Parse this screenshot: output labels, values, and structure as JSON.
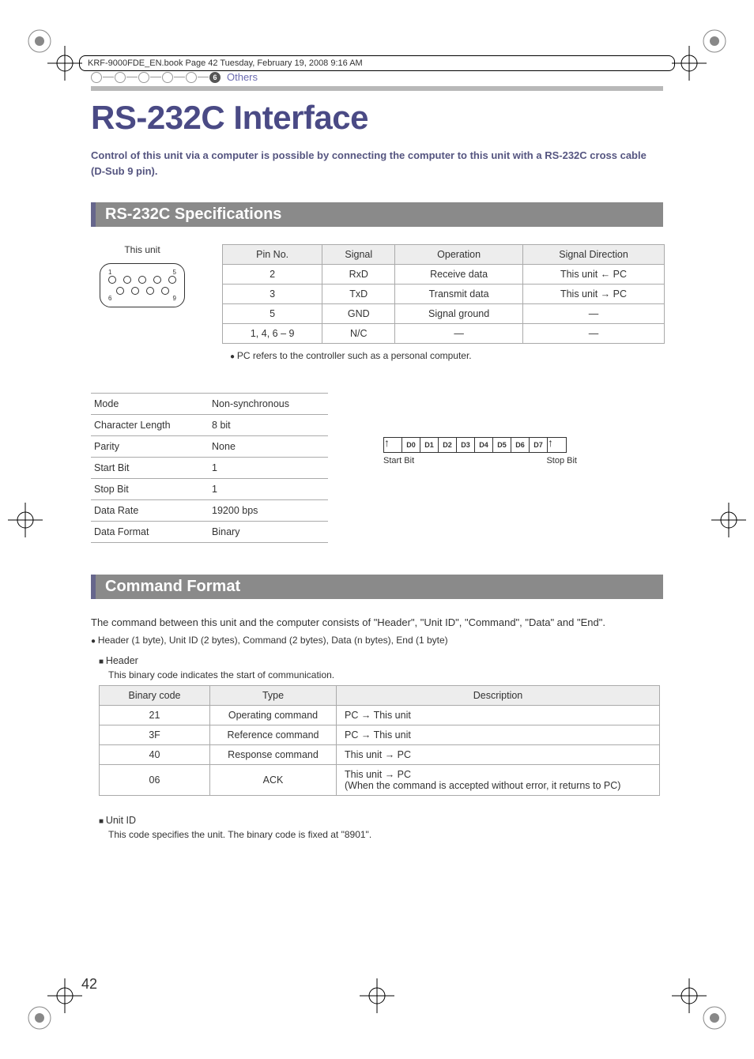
{
  "book_header": "KRF-9000FDE_EN.book  Page 42  Tuesday, February 19, 2008  9:16 AM",
  "breadcrumb": {
    "active_index": "6",
    "label": "Others"
  },
  "title": "RS-232C Interface",
  "intro": "Control of this unit via a computer is possible by connecting the computer to this unit with a RS-232C cross cable (D-Sub 9 pin).",
  "section1_head": "RS-232C Specifications",
  "connector_label": "This unit",
  "spec_headers": [
    "Pin No.",
    "Signal",
    "Operation",
    "Signal Direction"
  ],
  "spec_rows": [
    {
      "pin": "2",
      "signal": "RxD",
      "op": "Receive data",
      "dir": "This unit ← PC"
    },
    {
      "pin": "3",
      "signal": "TxD",
      "op": "Transmit data",
      "dir": "This unit → PC"
    },
    {
      "pin": "5",
      "signal": "GND",
      "op": "Signal ground",
      "dir": "—"
    },
    {
      "pin": "1, 4, 6 – 9",
      "signal": "N/C",
      "op": "—",
      "dir": "—"
    }
  ],
  "spec_note": "PC refers to the controller such as a personal computer.",
  "params": [
    {
      "k": "Mode",
      "v": "Non-synchronous"
    },
    {
      "k": "Character Length",
      "v": "8 bit"
    },
    {
      "k": "Parity",
      "v": "None"
    },
    {
      "k": "Start Bit",
      "v": "1"
    },
    {
      "k": "Stop Bit",
      "v": "1"
    },
    {
      "k": "Data Rate",
      "v": "19200 bps"
    },
    {
      "k": "Data Format",
      "v": "Binary"
    }
  ],
  "bits": [
    "D0",
    "D1",
    "D2",
    "D3",
    "D4",
    "D5",
    "D6",
    "D7"
  ],
  "bit_start": "Start Bit",
  "bit_stop": "Stop Bit",
  "section2_head": "Command Format",
  "cmd_intro": "The command between this unit and the computer consists of \"Header\", \"Unit ID\", \"Command\", \"Data\" and \"End\".",
  "cmd_note": "Header (1 byte), Unit ID (2 bytes), Command (2 bytes), Data (n bytes), End (1 byte)",
  "header_label": "Header",
  "header_desc": "This binary code indicates the start of communication.",
  "header_tbl_headers": [
    "Binary code",
    "Type",
    "Description"
  ],
  "header_tbl_rows": [
    {
      "code": "21",
      "type": "Operating command",
      "desc": "PC → This unit"
    },
    {
      "code": "3F",
      "type": "Reference command",
      "desc": "PC → This unit"
    },
    {
      "code": "40",
      "type": "Response command",
      "desc": "This unit → PC"
    },
    {
      "code": "06",
      "type": "ACK",
      "desc": "This unit → PC\n(When the command is accepted without error, it returns to PC)"
    }
  ],
  "unitid_label": "Unit ID",
  "unitid_desc": "This code specifies the unit. The binary code is fixed at \"8901\".",
  "page_number": "42"
}
